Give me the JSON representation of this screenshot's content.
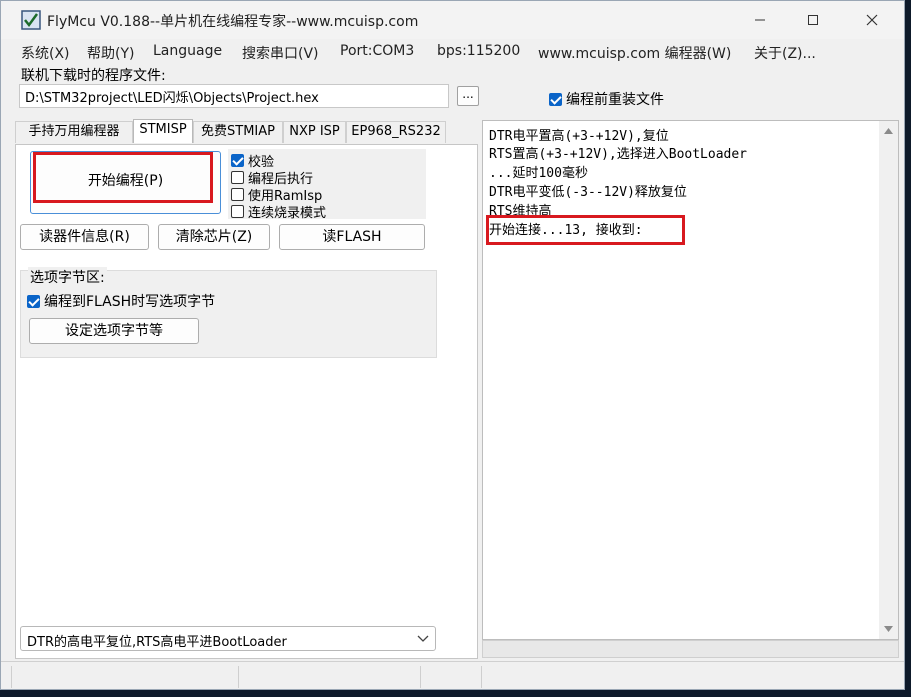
{
  "window": {
    "title": "FlyMcu V0.188--单片机在线编程专家--www.mcuisp.com"
  },
  "menu": [
    "系统(X)",
    "帮助(Y)",
    "Language",
    "搜索串口(V)",
    "Port:COM3",
    "bps:115200",
    "www.mcuisp.com 编程器(W)",
    "关于(Z)..."
  ],
  "file": {
    "label": "联机下载时的程序文件:",
    "path": "D:\\STM32project\\LED闪烁\\Objects\\Project.hex",
    "browse_label": "...",
    "reload_label": "编程前重装文件",
    "reload_checked": true
  },
  "tabs": [
    "手持万用编程器",
    "STMISP",
    "免费STMIAP",
    "NXP ISP",
    "EP968_RS232"
  ],
  "active_tab": 1,
  "program": {
    "start_label": "开始编程(P)",
    "options": [
      {
        "label": "校验",
        "checked": true
      },
      {
        "label": "编程后执行",
        "checked": false
      },
      {
        "label": "使用RamIsp",
        "checked": false
      },
      {
        "label": "连续烧录模式",
        "checked": false
      }
    ],
    "read_info_label": "读器件信息(R)",
    "erase_label": "清除芯片(Z)",
    "read_flash_label": "读FLASH"
  },
  "option_bytes": {
    "title": "选项字节区:",
    "write_label": "编程到FLASH时写选项字节",
    "write_checked": true,
    "set_label": "设定选项字节等"
  },
  "mode_select": {
    "value": "DTR的高电平复位,RTS高电平进BootLoader"
  },
  "log": [
    "DTR电平置高(+3-+12V),复位",
    "RTS置高(+3-+12V),选择进入BootLoader",
    "...延时100毫秒",
    "DTR电平变低(-3--12V)释放复位",
    "RTS维持高",
    "开始连接...13, 接收到:"
  ],
  "colors": {
    "highlight": "#d8191f",
    "check": "#0a64c8"
  }
}
